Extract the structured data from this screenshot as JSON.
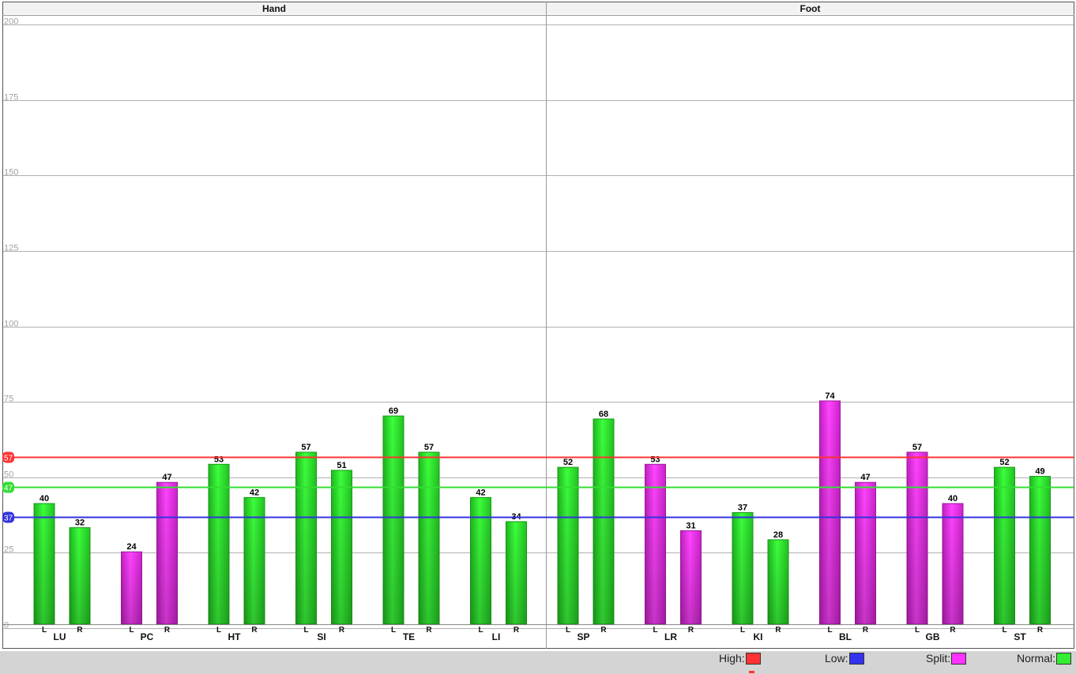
{
  "chart_data": {
    "type": "bar",
    "panels": [
      {
        "title": "Hand",
        "groups": [
          {
            "name": "LU",
            "L": 40,
            "R": 32,
            "split": false
          },
          {
            "name": "PC",
            "L": 24,
            "R": 47,
            "split": true
          },
          {
            "name": "HT",
            "L": 53,
            "R": 42,
            "split": false
          },
          {
            "name": "SI",
            "L": 57,
            "R": 51,
            "split": false
          },
          {
            "name": "TE",
            "L": 69,
            "R": 57,
            "split": false
          },
          {
            "name": "LI",
            "L": 42,
            "R": 34,
            "split": false
          }
        ]
      },
      {
        "title": "Foot",
        "groups": [
          {
            "name": "SP",
            "L": 52,
            "R": 68,
            "split": false
          },
          {
            "name": "LR",
            "L": 53,
            "R": 31,
            "split": true
          },
          {
            "name": "KI",
            "L": 37,
            "R": 28,
            "split": false
          },
          {
            "name": "BL",
            "L": 74,
            "R": 47,
            "split": true
          },
          {
            "name": "GB",
            "L": 57,
            "R": 40,
            "split": true
          },
          {
            "name": "ST",
            "L": 52,
            "R": 49,
            "split": false
          }
        ]
      }
    ],
    "side_labels": [
      "L",
      "R"
    ],
    "ylim": [
      0,
      200
    ],
    "yticks": [
      0,
      25,
      50,
      75,
      100,
      125,
      150,
      175,
      200
    ],
    "reference_lines": [
      {
        "name": "High",
        "value": 57,
        "color": "#ff3333"
      },
      {
        "name": "Normal",
        "value": 47,
        "color": "#33dd33"
      },
      {
        "name": "Low",
        "value": 37,
        "color": "#3333dd"
      }
    ],
    "grid": true,
    "colors": {
      "normal": "#33ee33",
      "split": "#ff33ff"
    }
  },
  "legend": [
    {
      "label": "High:",
      "color": "#ff3333"
    },
    {
      "label": "Low:",
      "color": "#3333ee"
    },
    {
      "label": "Split:",
      "color": "#ff33ff"
    },
    {
      "label": "Normal:",
      "color": "#33ee33"
    }
  ]
}
